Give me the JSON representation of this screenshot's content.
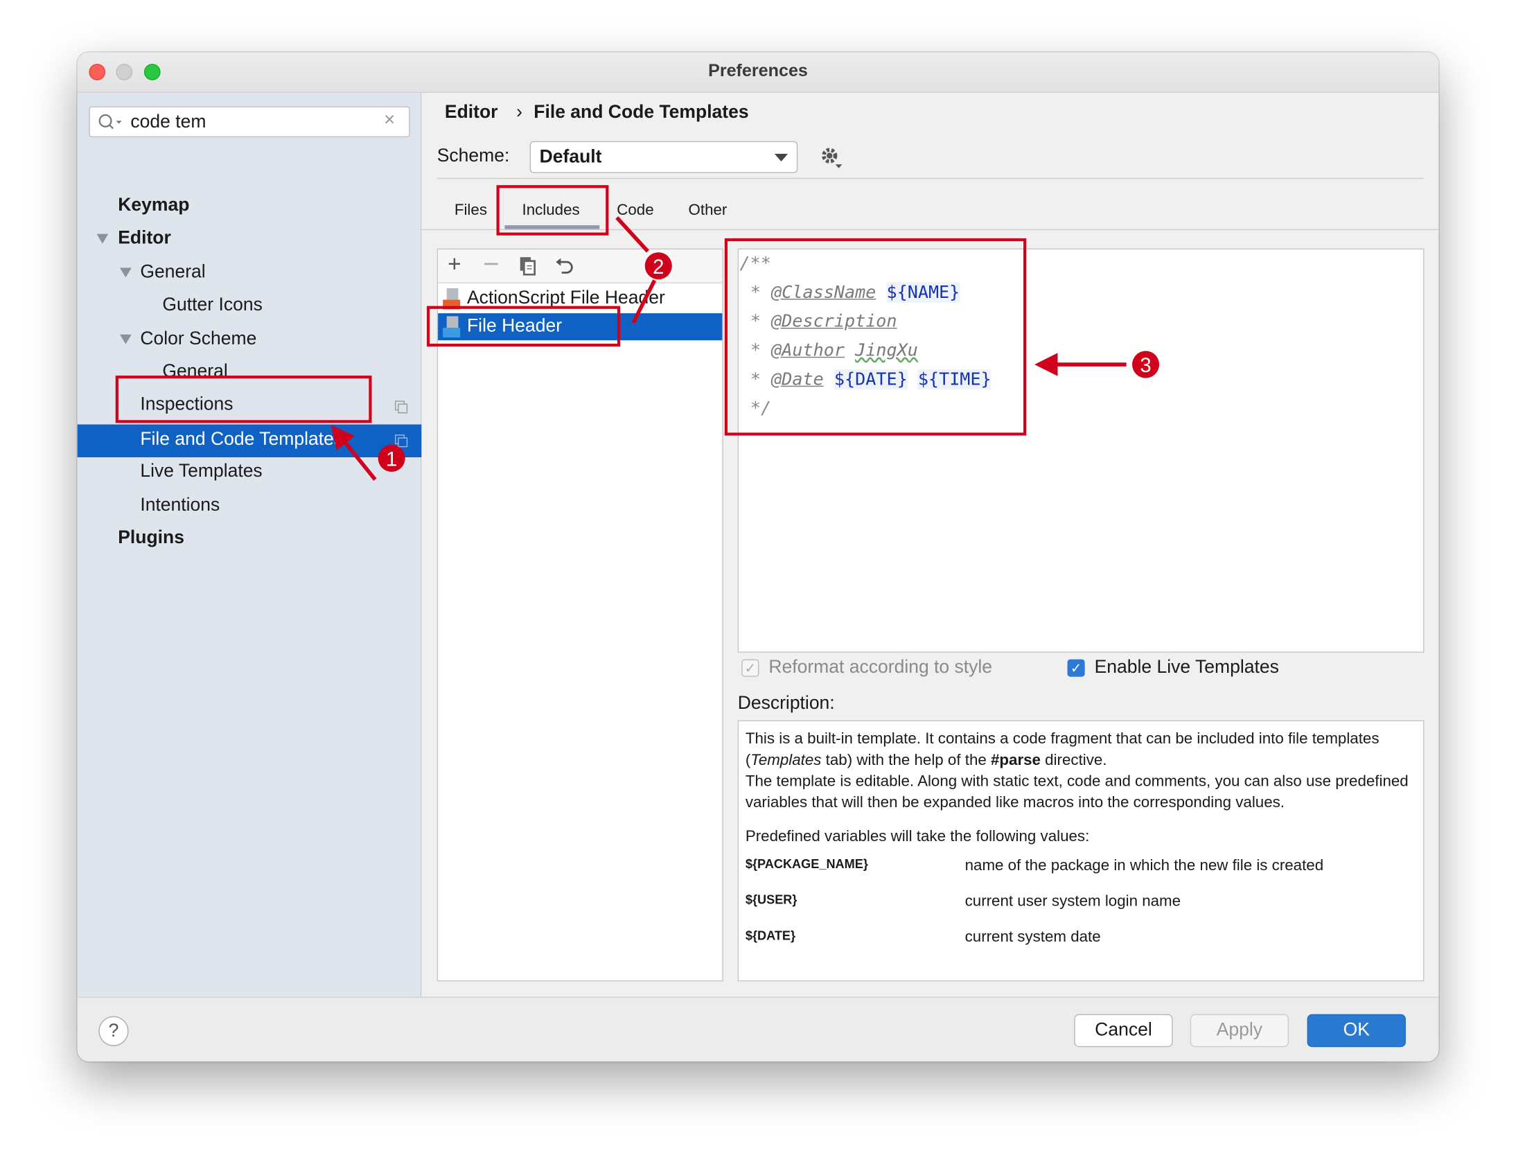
{
  "window": {
    "title": "Preferences"
  },
  "sidebar": {
    "search": {
      "value": "code tem"
    },
    "items": [
      {
        "label": "Keymap"
      },
      {
        "label": "Editor"
      },
      {
        "label": "General"
      },
      {
        "label": "Gutter Icons"
      },
      {
        "label": "Color Scheme"
      },
      {
        "label": "General"
      },
      {
        "label": "Inspections"
      },
      {
        "label": "File and Code Templates"
      },
      {
        "label": "Live Templates"
      },
      {
        "label": "Intentions"
      },
      {
        "label": "Plugins"
      }
    ]
  },
  "breadcrumb": {
    "parent": "Editor",
    "separator": "›",
    "current": "File and Code Templates"
  },
  "scheme": {
    "label": "Scheme:",
    "value": "Default"
  },
  "tabs": [
    {
      "label": "Files"
    },
    {
      "label": "Includes",
      "selected": true
    },
    {
      "label": "Code"
    },
    {
      "label": "Other"
    }
  ],
  "templates": [
    {
      "name": "ActionScript File Header",
      "icon_badge": "AS"
    },
    {
      "name": "File Header",
      "icon_badge": "J",
      "selected": true
    }
  ],
  "editor": {
    "open": "/**",
    "star": "*",
    "close": "*/",
    "lines": [
      {
        "tag": "@ClassName",
        "vars": [
          "${NAME}"
        ],
        "text": ""
      },
      {
        "tag": "@Description",
        "vars": [],
        "text": ""
      },
      {
        "tag": "@Author",
        "vars": [],
        "text": "JingXu"
      },
      {
        "tag": "@Date",
        "vars": [
          "${DATE}",
          "${TIME}"
        ],
        "text": ""
      }
    ]
  },
  "options": {
    "reformat": {
      "label": "Reformat according to style",
      "checked": true,
      "disabled": true
    },
    "live_templates": {
      "label": "Enable Live Templates",
      "checked": true
    }
  },
  "description": {
    "label": "Description:",
    "p1a": "This is a built-in template. It contains a code fragment that can be included into file templates (",
    "p1b": "Templates",
    "p1c": " tab) with the help of the ",
    "p1d": "#parse",
    "p1e": " directive.",
    "p2": "The template is editable. Along with static text, code and comments, you can also use predefined variables that will then be expanded like macros into the corresponding values.",
    "p3": "Predefined variables will take the following values:",
    "vars": [
      {
        "name": "${PACKAGE_NAME}",
        "desc": "name of the package in which the new file is created"
      },
      {
        "name": "${USER}",
        "desc": "current user system login name"
      },
      {
        "name": "${DATE}",
        "desc": "current system date"
      }
    ]
  },
  "footer": {
    "help": "?",
    "cancel": "Cancel",
    "apply": "Apply",
    "ok": "OK"
  },
  "annotations": [
    "1",
    "2",
    "3"
  ],
  "colors": {
    "selection": "#0f62c4",
    "annotation": "#d0021b",
    "ok_button": "#2a7ad2"
  }
}
